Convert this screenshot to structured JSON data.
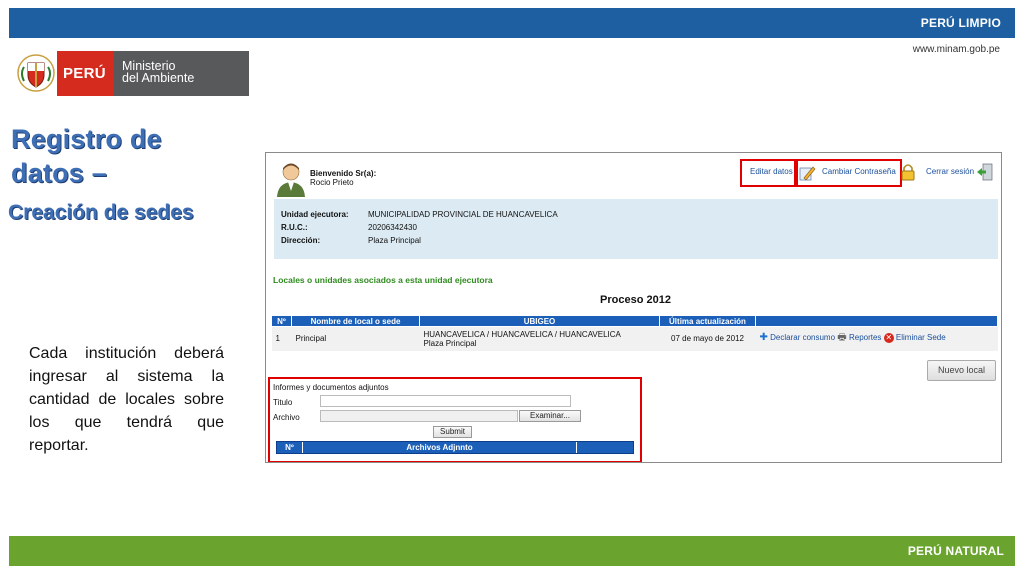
{
  "header": {
    "bar_label": "PERÚ LIMPIO",
    "url": "www.minam.gob.pe",
    "logo": {
      "country": "PERÚ",
      "ministry_line1": "Ministerio",
      "ministry_line2": "del Ambiente"
    }
  },
  "slide": {
    "title_line1": "Registro de",
    "title_line2": "datos –",
    "subtitle": "Creación de sedes",
    "description": "Cada institución deberá ingresar al sistema la cantidad de locales sobre los que tendrá que reportar."
  },
  "app": {
    "welcome_label": "Bienvenido Sr(a):",
    "user_name": "Rocio Prieto",
    "links": {
      "edit": "Editar datos",
      "change_password": "Cambiar Contraseña",
      "logout": "Cerrar sesión"
    },
    "info": [
      {
        "label": "Unidad ejecutora:",
        "value": "MUNICIPALIDAD PROVINCIAL DE HUANCAVELICA"
      },
      {
        "label": "R.U.C.:",
        "value": "20206342430"
      },
      {
        "label": "Dirección:",
        "value": "Plaza Principal"
      }
    ],
    "locales_title": "Locales o unidades asociados a esta unidad ejecutora",
    "process_title": "Proceso 2012",
    "table": {
      "headers": [
        "Nº",
        "Nombre de local o sede",
        "UBIGEO",
        "Última actualización",
        ""
      ],
      "rows": [
        {
          "num": "1",
          "name": "Principal",
          "ubigeo_line1": "HUANCAVELICA / HUANCAVELICA / HUANCAVELICA",
          "ubigeo_line2": "Plaza Principal",
          "updated": "07 de mayo de 2012",
          "actions": {
            "declare": "Declarar consumo",
            "reports": "Reportes",
            "delete": "Eliminar Sede"
          }
        }
      ]
    },
    "new_button": "Nuevo local",
    "attachments": {
      "heading": "Informes y documentos adjuntos",
      "title_label": "Titulo",
      "file_label": "Archivo",
      "title_value": "",
      "file_value": "",
      "browse_button": "Examinar...",
      "submit_button": "Submit",
      "headers": [
        "Nº",
        "Archivos Adjnnto"
      ]
    }
  },
  "footer": {
    "bar_label": "PERÚ NATURAL"
  },
  "colors": {
    "top_bar": "#1d5fa0",
    "bottom_bar": "#6aa42f",
    "highlight": "#e00000",
    "title": "#3e6fb5"
  }
}
